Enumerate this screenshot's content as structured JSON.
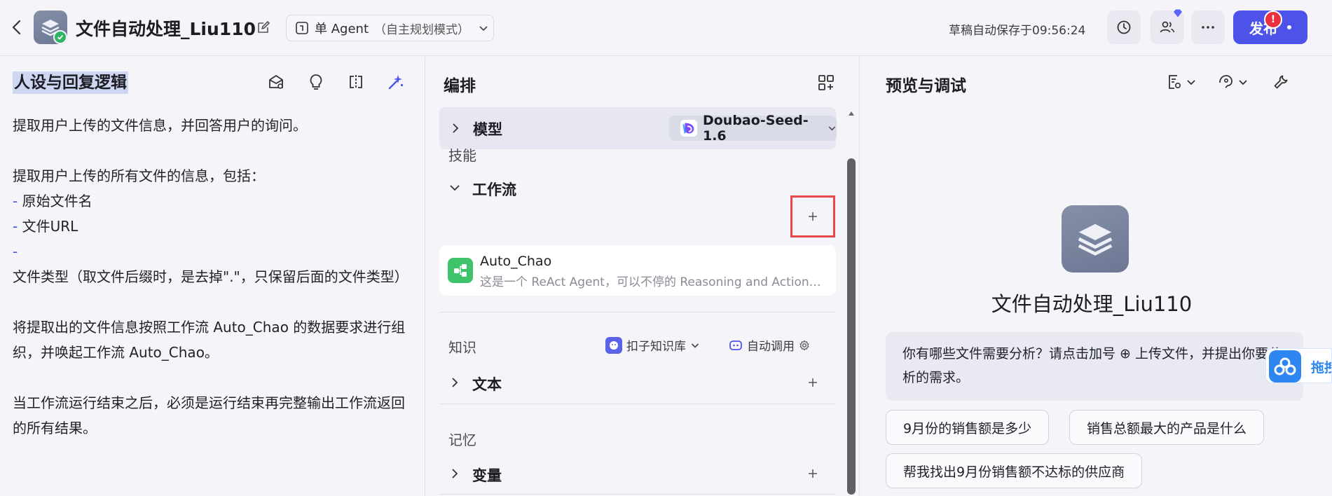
{
  "header": {
    "title": "文件自动处理_Liu110",
    "mode_label": "单 Agent",
    "mode_sub": "（自主规划模式）",
    "autosave": "草稿自动保存于09:56:24",
    "publish_label": "发布",
    "alert_count": "!"
  },
  "left": {
    "title": "人设与回复逻辑",
    "lines": [
      "提取用户上传的文件信息，并回答用户的询问。",
      "",
      "提取用户上传的所有文件的信息，包括：",
      {
        "dash": "- ",
        "text": "原始文件名"
      },
      {
        "dash": "- ",
        "text": "文件URL"
      },
      {
        "dash": "- ",
        "text": "文件类型（取文件后缀时，是去掉\".\"，只保留后面的文件类型）"
      },
      "",
      "将提取出的文件信息按照工作流 Auto_Chao 的数据要求进行组织，并唤起工作流 Auto_Chao。",
      "",
      "当工作流运行结束之后，必须是运行结束再完整输出工作流返回的所有结果。"
    ]
  },
  "middle": {
    "title": "编排",
    "model_label": "模型",
    "model_value": "Doubao-Seed-1.6",
    "skills_label": "技能",
    "workflow_label": "工作流",
    "workflow_card": {
      "name": "Auto_Chao",
      "desc": "这是一个 ReAct Agent，可以不停的 Reasoning and Action，直到完成任务"
    },
    "knowledge_label": "知识",
    "kb_select": "扣子知识库",
    "auto_call": "自动调用",
    "text_label": "文本",
    "memory_label": "记忆",
    "variable_label": "变量"
  },
  "right": {
    "title": "预览与调试",
    "bot_name": "文件自动处理_Liu110",
    "opener": "你有哪些文件需要分析？请点击加号 ⊕ 上传文件，并提出你要分析的需求。",
    "suggestions": [
      "9月份的销售额是多少",
      "销售总额最大的产品是什么",
      "帮我找出9月份销售额不达标的供应商"
    ],
    "float_label": "拖拽"
  },
  "colors": {
    "accent": "#4d53e8",
    "highlight": "#e8474c",
    "workflow_green": "#3ec26a"
  }
}
